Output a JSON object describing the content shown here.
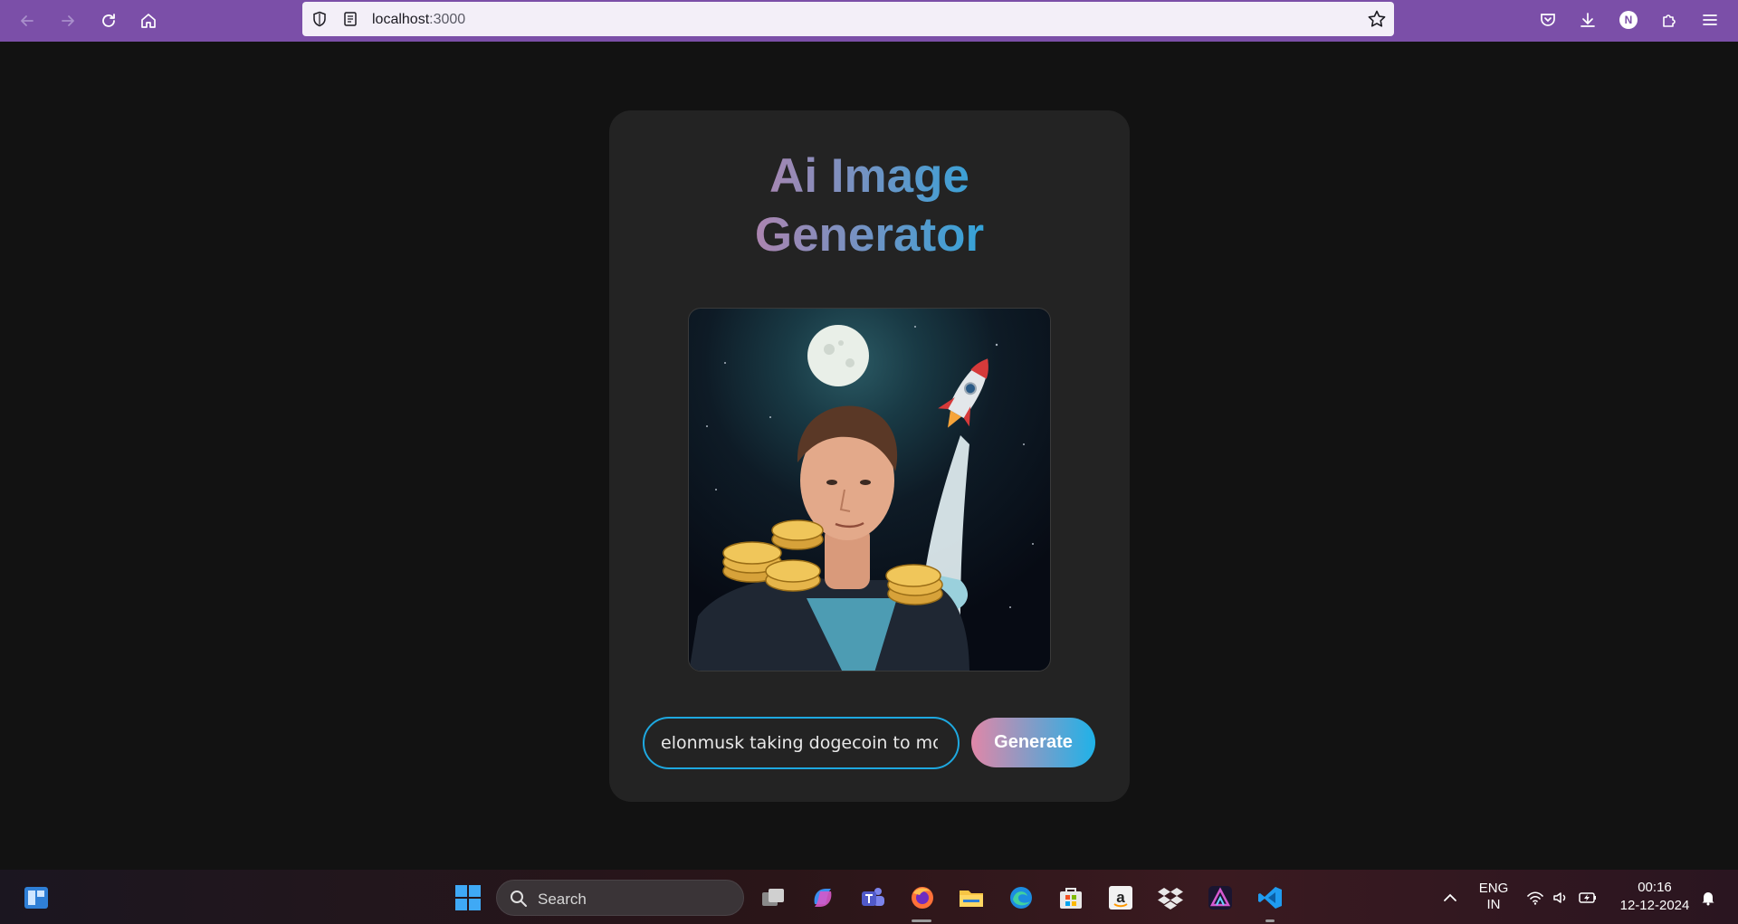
{
  "browser": {
    "url_host": "localhost",
    "url_port": ":3000",
    "profile_initial": "N"
  },
  "app": {
    "title": "Ai Image Generator",
    "title_line1": "Ai Image",
    "title_line2": "Generator",
    "prompt_value": "elonmusk taking dogecoin to moon",
    "generate_label": "Generate"
  },
  "taskbar": {
    "search_label": "Search",
    "language_line1": "ENG",
    "language_line2": "IN",
    "time": "00:16",
    "date": "12-12-2024"
  },
  "colors": {
    "browser_bar": "#7b4fa8",
    "page_background": "#121212",
    "card_background": "#232323",
    "accent_blue": "#1ea8e0",
    "accent_pink": "#e087a8"
  }
}
